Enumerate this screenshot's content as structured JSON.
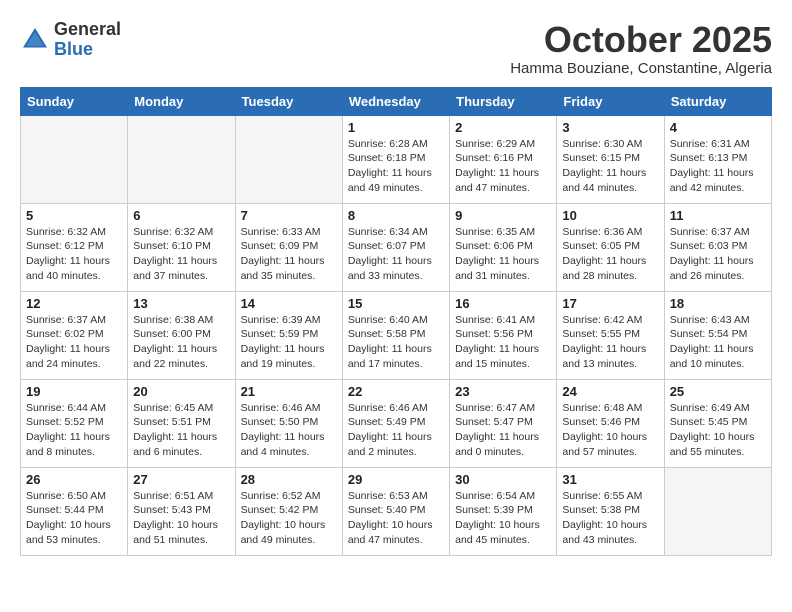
{
  "header": {
    "logo_general": "General",
    "logo_blue": "Blue",
    "month": "October 2025",
    "location": "Hamma Bouziane, Constantine, Algeria"
  },
  "weekdays": [
    "Sunday",
    "Monday",
    "Tuesday",
    "Wednesday",
    "Thursday",
    "Friday",
    "Saturday"
  ],
  "weeks": [
    [
      {
        "day": "",
        "info": ""
      },
      {
        "day": "",
        "info": ""
      },
      {
        "day": "",
        "info": ""
      },
      {
        "day": "1",
        "info": "Sunrise: 6:28 AM\nSunset: 6:18 PM\nDaylight: 11 hours and 49 minutes."
      },
      {
        "day": "2",
        "info": "Sunrise: 6:29 AM\nSunset: 6:16 PM\nDaylight: 11 hours and 47 minutes."
      },
      {
        "day": "3",
        "info": "Sunrise: 6:30 AM\nSunset: 6:15 PM\nDaylight: 11 hours and 44 minutes."
      },
      {
        "day": "4",
        "info": "Sunrise: 6:31 AM\nSunset: 6:13 PM\nDaylight: 11 hours and 42 minutes."
      }
    ],
    [
      {
        "day": "5",
        "info": "Sunrise: 6:32 AM\nSunset: 6:12 PM\nDaylight: 11 hours and 40 minutes."
      },
      {
        "day": "6",
        "info": "Sunrise: 6:32 AM\nSunset: 6:10 PM\nDaylight: 11 hours and 37 minutes."
      },
      {
        "day": "7",
        "info": "Sunrise: 6:33 AM\nSunset: 6:09 PM\nDaylight: 11 hours and 35 minutes."
      },
      {
        "day": "8",
        "info": "Sunrise: 6:34 AM\nSunset: 6:07 PM\nDaylight: 11 hours and 33 minutes."
      },
      {
        "day": "9",
        "info": "Sunrise: 6:35 AM\nSunset: 6:06 PM\nDaylight: 11 hours and 31 minutes."
      },
      {
        "day": "10",
        "info": "Sunrise: 6:36 AM\nSunset: 6:05 PM\nDaylight: 11 hours and 28 minutes."
      },
      {
        "day": "11",
        "info": "Sunrise: 6:37 AM\nSunset: 6:03 PM\nDaylight: 11 hours and 26 minutes."
      }
    ],
    [
      {
        "day": "12",
        "info": "Sunrise: 6:37 AM\nSunset: 6:02 PM\nDaylight: 11 hours and 24 minutes."
      },
      {
        "day": "13",
        "info": "Sunrise: 6:38 AM\nSunset: 6:00 PM\nDaylight: 11 hours and 22 minutes."
      },
      {
        "day": "14",
        "info": "Sunrise: 6:39 AM\nSunset: 5:59 PM\nDaylight: 11 hours and 19 minutes."
      },
      {
        "day": "15",
        "info": "Sunrise: 6:40 AM\nSunset: 5:58 PM\nDaylight: 11 hours and 17 minutes."
      },
      {
        "day": "16",
        "info": "Sunrise: 6:41 AM\nSunset: 5:56 PM\nDaylight: 11 hours and 15 minutes."
      },
      {
        "day": "17",
        "info": "Sunrise: 6:42 AM\nSunset: 5:55 PM\nDaylight: 11 hours and 13 minutes."
      },
      {
        "day": "18",
        "info": "Sunrise: 6:43 AM\nSunset: 5:54 PM\nDaylight: 11 hours and 10 minutes."
      }
    ],
    [
      {
        "day": "19",
        "info": "Sunrise: 6:44 AM\nSunset: 5:52 PM\nDaylight: 11 hours and 8 minutes."
      },
      {
        "day": "20",
        "info": "Sunrise: 6:45 AM\nSunset: 5:51 PM\nDaylight: 11 hours and 6 minutes."
      },
      {
        "day": "21",
        "info": "Sunrise: 6:46 AM\nSunset: 5:50 PM\nDaylight: 11 hours and 4 minutes."
      },
      {
        "day": "22",
        "info": "Sunrise: 6:46 AM\nSunset: 5:49 PM\nDaylight: 11 hours and 2 minutes."
      },
      {
        "day": "23",
        "info": "Sunrise: 6:47 AM\nSunset: 5:47 PM\nDaylight: 11 hours and 0 minutes."
      },
      {
        "day": "24",
        "info": "Sunrise: 6:48 AM\nSunset: 5:46 PM\nDaylight: 10 hours and 57 minutes."
      },
      {
        "day": "25",
        "info": "Sunrise: 6:49 AM\nSunset: 5:45 PM\nDaylight: 10 hours and 55 minutes."
      }
    ],
    [
      {
        "day": "26",
        "info": "Sunrise: 6:50 AM\nSunset: 5:44 PM\nDaylight: 10 hours and 53 minutes."
      },
      {
        "day": "27",
        "info": "Sunrise: 6:51 AM\nSunset: 5:43 PM\nDaylight: 10 hours and 51 minutes."
      },
      {
        "day": "28",
        "info": "Sunrise: 6:52 AM\nSunset: 5:42 PM\nDaylight: 10 hours and 49 minutes."
      },
      {
        "day": "29",
        "info": "Sunrise: 6:53 AM\nSunset: 5:40 PM\nDaylight: 10 hours and 47 minutes."
      },
      {
        "day": "30",
        "info": "Sunrise: 6:54 AM\nSunset: 5:39 PM\nDaylight: 10 hours and 45 minutes."
      },
      {
        "day": "31",
        "info": "Sunrise: 6:55 AM\nSunset: 5:38 PM\nDaylight: 10 hours and 43 minutes."
      },
      {
        "day": "",
        "info": ""
      }
    ]
  ]
}
